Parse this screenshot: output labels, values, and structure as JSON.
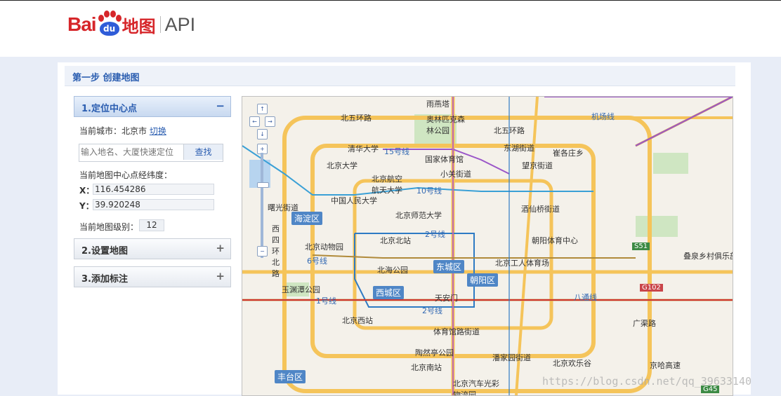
{
  "header": {
    "logo_bai": "Bai",
    "logo_du": "du",
    "logo_map": "地图",
    "logo_api": "API"
  },
  "step": {
    "title": "第一步 创建地图"
  },
  "panels": [
    {
      "label": "1.定位中心点",
      "toggle": "−",
      "expanded": true
    },
    {
      "label": "2.设置地图",
      "toggle": "+",
      "expanded": false
    },
    {
      "label": "3.添加标注",
      "toggle": "+",
      "expanded": false
    }
  ],
  "locate": {
    "city_prefix": "当前城市：北京市",
    "switch_link": "切换",
    "search_placeholder": "输入地名、大厦快速定位",
    "search_button": "查找",
    "coord_title": "当前地图中心点经纬度：",
    "x_label": "X：",
    "x_value": "116.454286",
    "y_label": "Y：",
    "y_value": "39.920248",
    "zoom_label": "当前地图级别：",
    "zoom_value": "12"
  },
  "map": {
    "controls": {
      "up": "↑",
      "left": "←",
      "right": "→",
      "down": "↓",
      "zoom_in": "+",
      "zoom_out": "−"
    },
    "districts": [
      "海淀区",
      "东城区",
      "朝阳区",
      "西城区",
      "丰台区"
    ],
    "places": [
      "北五环路",
      "雨燕塔",
      "奥林匹克森林公园",
      "北五环路",
      "机场线",
      "清华大学",
      "15号线",
      "国家体育馆",
      "东湖街道",
      "崔各庄乡",
      "北京大学",
      "北京航空航天大学",
      "小关街道",
      "望京街道",
      "10号线",
      "中国人民大学",
      "曙光街道",
      "北京师范大学",
      "酒仙桥街道",
      "2号线",
      "北京北站",
      "朝阳体育中心",
      "北京动物园",
      "6号线",
      "北海公园",
      "北京工人体育场",
      "玉渊潭公园",
      "天安门",
      "八通线",
      "1号线",
      "2号线",
      "北京西站",
      "体育馆路街道",
      "广渠路",
      "陶然亭公园",
      "潘家园街道",
      "北京欢乐谷",
      "京哈高速",
      "北京南站",
      "北京汽车光彩物流园",
      "叠泉乡村俱乐部",
      "西四环北路",
      "G102",
      "S51",
      "G45"
    ]
  },
  "watermark": "https://blog.csdn.net/qq_39633140",
  "colors": {
    "accent": "#2a5db0",
    "brand_red": "#d6262a",
    "brand_blue": "#2f5cd8",
    "district_bg": "#4f86c6"
  }
}
